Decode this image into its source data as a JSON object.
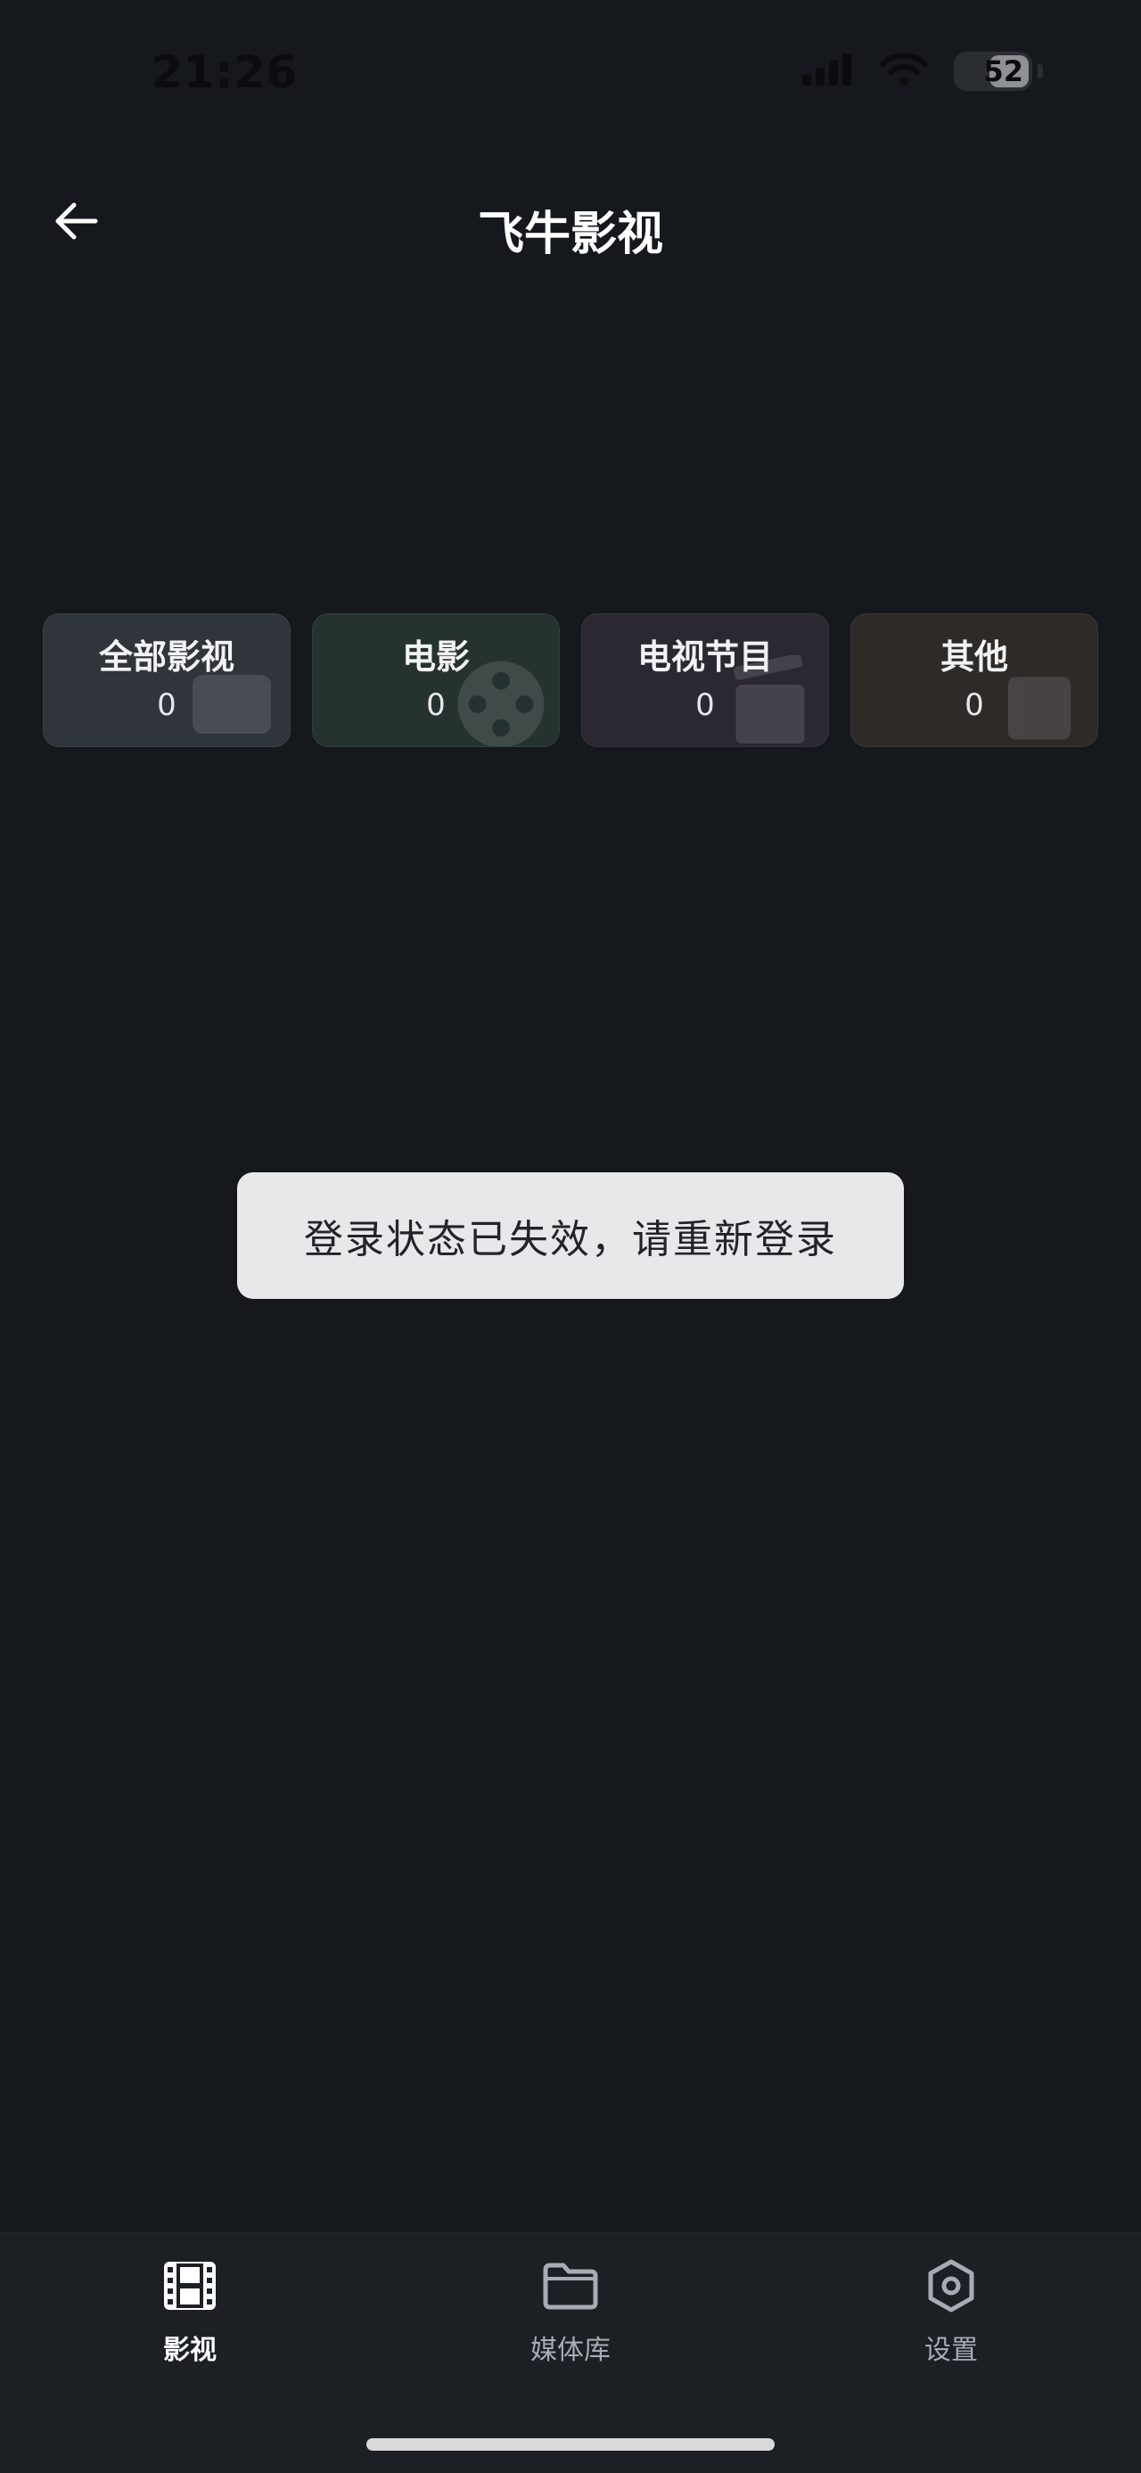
{
  "status_bar": {
    "time": "21:26",
    "battery": "52"
  },
  "header": {
    "title": "飞牛影视"
  },
  "categories": [
    {
      "name": "全部影视",
      "count": "0",
      "color": "#30343b",
      "icon": "film-reel-icon"
    },
    {
      "name": "电影",
      "count": "0",
      "color": "#263230",
      "icon": "film-reel-icon"
    },
    {
      "name": "电视节目",
      "count": "0",
      "color": "#2b2832",
      "icon": "clapperboard-icon"
    },
    {
      "name": "其他",
      "count": "0",
      "color": "#2e2a28",
      "icon": "box-icon"
    }
  ],
  "toast": {
    "message": "登录状态已失效，请重新登录"
  },
  "bottom_nav": {
    "items": [
      {
        "label": "影视",
        "icon": "film-icon",
        "active": true
      },
      {
        "label": "媒体库",
        "icon": "folder-icon",
        "active": false
      },
      {
        "label": "设置",
        "icon": "gear-icon",
        "active": false
      }
    ]
  },
  "colors": {
    "background": "#15181c",
    "nav_background": "#1c1f24",
    "toast_background": "#e8e8ea"
  }
}
